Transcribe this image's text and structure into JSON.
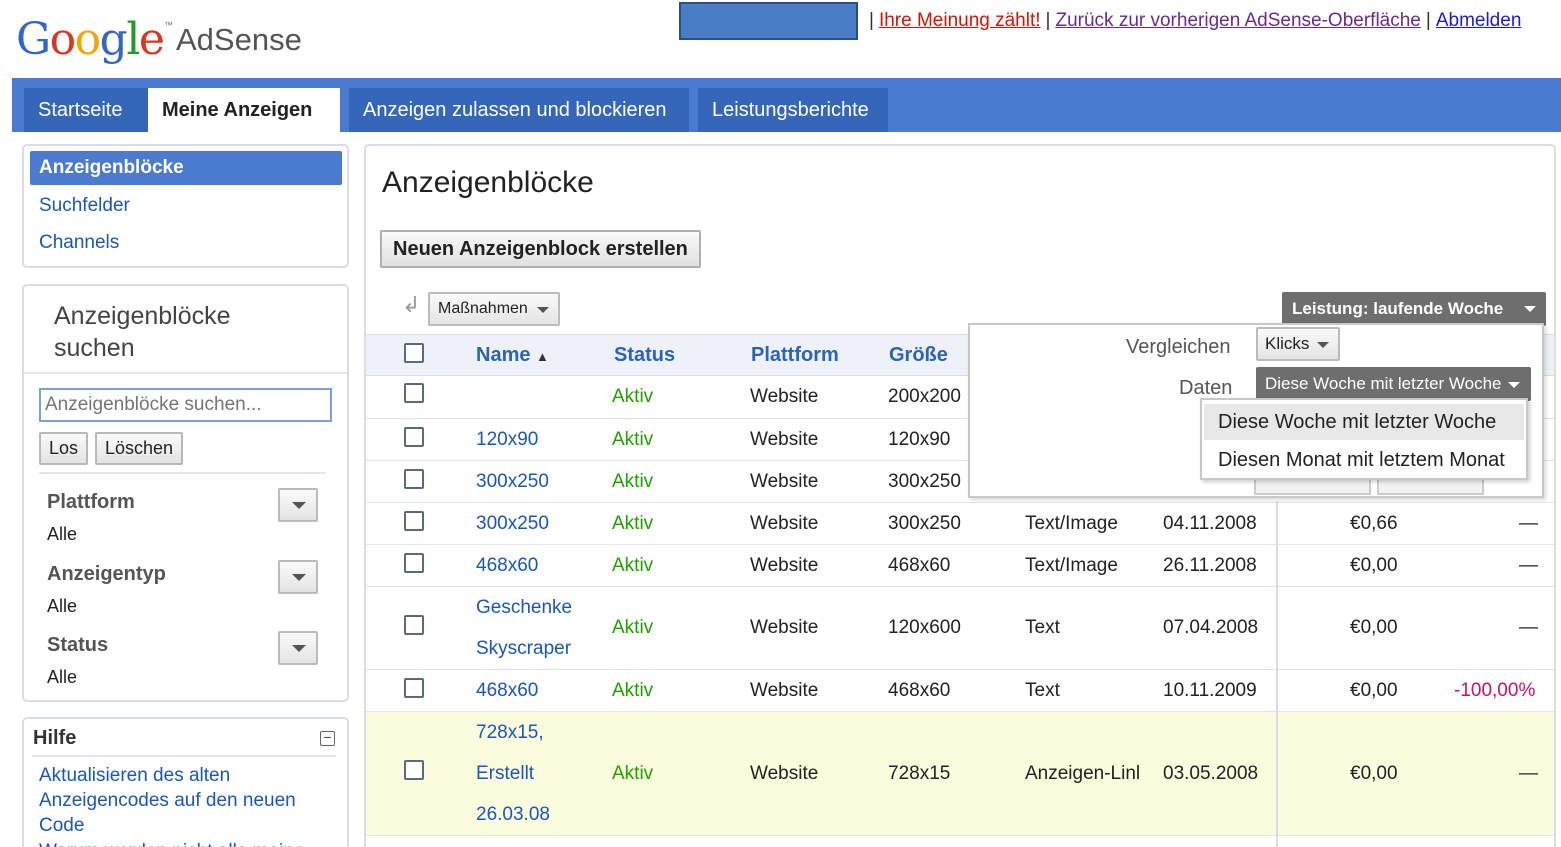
{
  "header": {
    "logo_google": "Google",
    "logo_tm": "™",
    "logo_product": "AdSense",
    "links": [
      {
        "label": "Ihre Meinung zählt!",
        "color": "#dd1100"
      },
      {
        "label": "Zurück zur vorherigen AdSense-Oberfläche",
        "color": "#6a2b8c"
      },
      {
        "label": "Abmelden",
        "color": "#1a1ae0"
      }
    ],
    "separator": "|"
  },
  "nav": {
    "tabs": [
      {
        "label": "Startseite"
      },
      {
        "label": "Meine Anzeigen"
      },
      {
        "label": "Anzeigen zulassen und blockieren"
      },
      {
        "label": "Leistungsberichte"
      }
    ]
  },
  "sidebar": {
    "items": [
      {
        "label": "Anzeigenblöcke"
      },
      {
        "label": "Suchfelder"
      },
      {
        "label": "Channels"
      }
    ],
    "search": {
      "title_line1": "Anzeigenblöcke",
      "title_line2": "suchen",
      "placeholder": "Anzeigenblöcke suchen...",
      "go_label": "Los",
      "clear_label": "Löschen",
      "filters": [
        {
          "label": "Plattform",
          "value": "Alle"
        },
        {
          "label": "Anzeigentyp",
          "value": "Alle"
        },
        {
          "label": "Status",
          "value": "Alle"
        }
      ]
    },
    "help": {
      "title": "Hilfe",
      "toggle": "−",
      "link1": "Aktualisieren des alten Anzeigencodes auf den neuen Code",
      "link2": "Warum werden nicht alle meine"
    }
  },
  "main": {
    "title": "Anzeigenblöcke",
    "create_label": "Neuen Anzeigenblock erstellen",
    "actions_label": "Maßnahmen",
    "performance_label": "Leistung: laufende Woche",
    "columns": {
      "name": "Name",
      "sort_arrow": "▲",
      "status": "Status",
      "platform": "Plattform",
      "size": "Größe"
    },
    "rows": [
      {
        "name": "",
        "status": "Aktiv",
        "platform": "Website",
        "size": "200x200",
        "type": "",
        "date": "",
        "earnings": "",
        "change": ""
      },
      {
        "name": "120x90",
        "status": "Aktiv",
        "platform": "Website",
        "size": "120x90",
        "type": "",
        "date": "",
        "earnings": "",
        "change": ""
      },
      {
        "name": "300x250",
        "status": "Aktiv",
        "platform": "Website",
        "size": "300x250",
        "type": "",
        "date": "",
        "earnings": "",
        "change": ""
      },
      {
        "name": "300x250",
        "status": "Aktiv",
        "platform": "Website",
        "size": "300x250",
        "type": "Text/Image",
        "date": "04.11.2008",
        "earnings": "€0,66",
        "change": "—"
      },
      {
        "name": "468x60",
        "status": "Aktiv",
        "platform": "Website",
        "size": "468x60",
        "type": "Text/Image",
        "date": "26.11.2008",
        "earnings": "€0,00",
        "change": "—"
      },
      {
        "name": "Geschenke Skyscraper",
        "status": "Aktiv",
        "platform": "Website",
        "size": "120x600",
        "type": "Text",
        "date": "07.04.2008",
        "earnings": "€0,00",
        "change": "—"
      },
      {
        "name": "468x60",
        "status": "Aktiv",
        "platform": "Website",
        "size": "468x60",
        "type": "Text",
        "date": "10.11.2009",
        "earnings": "€0,00",
        "change": "-100,00%"
      },
      {
        "name": "728x15, Erstellt 26.03.08",
        "status": "Aktiv",
        "platform": "Website",
        "size": "728x15",
        "type": "Anzeigen-Linl",
        "date": "03.05.2008",
        "earnings": "€0,00",
        "change": "—"
      }
    ]
  },
  "popup": {
    "compare_label": "Vergleichen",
    "compare_value": "Klicks",
    "data_label": "Daten",
    "data_value": "Diese Woche mit letzter Woche",
    "options": [
      {
        "label": "Diese Woche mit letzter Woche",
        "selected": true
      },
      {
        "label": "Diesen Monat mit letztem Monat",
        "selected": false
      }
    ]
  }
}
